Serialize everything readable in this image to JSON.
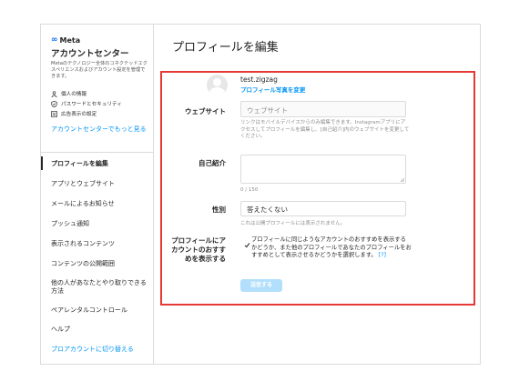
{
  "sidebar": {
    "brand": "Meta",
    "title": "アカウントセンター",
    "description": "Metaのテクノロジー全体のコネクテッドエクスペリエンスおよびアカウント設定を管理できます。",
    "links": [
      {
        "label": "個人の情報",
        "icon": "person-icon"
      },
      {
        "label": "パスワードとセキュリティ",
        "icon": "shield-icon"
      },
      {
        "label": "広告表示の設定",
        "icon": "ad-icon"
      }
    ],
    "account_center_link": "アカウントセンターでもっと見る",
    "nav": [
      {
        "label": "プロフィールを編集",
        "active": true
      },
      {
        "label": "アプリとウェブサイト"
      },
      {
        "label": "メールによるお知らせ"
      },
      {
        "label": "プッシュ通知"
      },
      {
        "label": "表示されるコンテンツ"
      },
      {
        "label": "コンテンツの公開範囲"
      },
      {
        "label": "他の人があなたとやり取りできる方法"
      },
      {
        "label": "ペアレンタルコントロール"
      },
      {
        "label": "ヘルプ"
      },
      {
        "label": "プロアカウントに切り替える"
      }
    ]
  },
  "main": {
    "title": "プロフィールを編集",
    "username": "test.zigzag",
    "change_photo": "プロフィール写真を変更",
    "website": {
      "label": "ウェブサイト",
      "placeholder": "ウェブサイト",
      "hint": "リンクはモバイルデバイスからのみ編集できます。Instagramアプリにアクセスしてプロフィールを編集し、[自己紹介]内のウェブサイトを変更してください。"
    },
    "bio": {
      "label": "自己紹介",
      "counter": "0 / 150"
    },
    "gender": {
      "label": "性別",
      "value": "答えたくない",
      "hint": "これは公開プロフィールには表示されません。"
    },
    "suggestions": {
      "label": "プロフィールにアカウントのおすすめを表示する",
      "checked": true,
      "text": "プロフィールに同じようなアカウントのおすすめを表示するかどうか、また他のプロフィールであなたのプロフィールをおすすめとして表示させるかどうかを選択します。",
      "help": "[?]"
    },
    "submit": "送信する"
  },
  "colors": {
    "accent": "#0095f6",
    "highlight": "#e53935",
    "submit_disabled": "#b2dffc"
  }
}
